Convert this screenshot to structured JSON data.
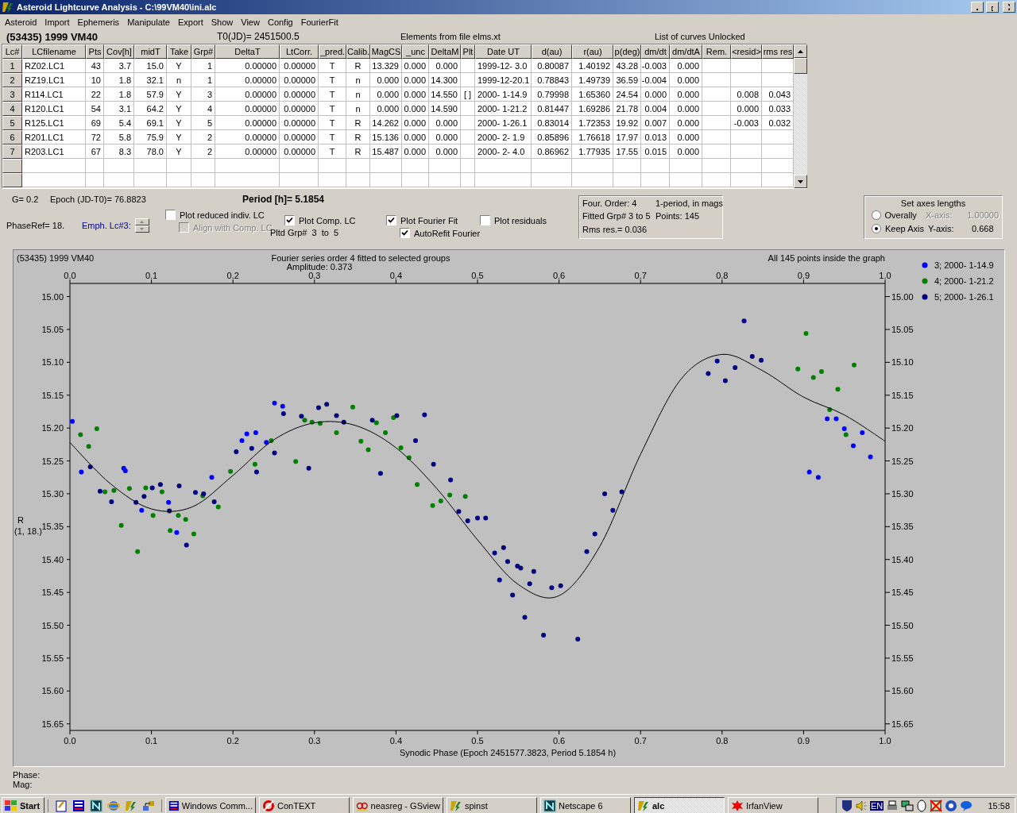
{
  "window": {
    "title": "Asteroid Lightcurve Analysis - C:\\99VM40\\ini.alc"
  },
  "menu": [
    "Asteroid",
    "Import",
    "Ephemeris",
    "Manipulate",
    "Export",
    "Show",
    "View",
    "Config",
    "FourierFit"
  ],
  "info": {
    "object": "(53435) 1999 VM40",
    "t0": "T0(JD)= 2451500.5",
    "elements": "Elements from file elms.xt",
    "list_state": "List of curves Unlocked"
  },
  "table": {
    "columns": [
      "Lc#",
      "LCfilename",
      "Pts",
      "Cov[h]",
      "midT",
      "Take",
      "Grp#",
      "DeltaT",
      "LtCorr.",
      "_pred.",
      "Calib.",
      "MagCS",
      "_unc",
      "DeltaM",
      "Plt",
      "Date UT",
      "d(au)",
      "r(au)",
      "p(deg)",
      "dm/dt",
      "dm/dtA",
      "Rem.",
      "<resid>",
      "rms res"
    ],
    "rows": [
      [
        "1",
        "RZ02.LC1",
        "43",
        "3.7",
        "15.0",
        "Y",
        "1",
        "0.00000",
        "0.00000",
        "T",
        "R",
        "13.329",
        "0.000",
        "0.000",
        null,
        "1999-12- 3.0",
        "0.80087",
        "1.40192",
        "43.28",
        "-0.003",
        "0.000",
        null,
        null,
        null
      ],
      [
        "2",
        "RZ19.LC1",
        "10",
        "1.8",
        "32.1",
        "n",
        "1",
        "0.00000",
        "0.00000",
        "T",
        "n",
        "0.000",
        "0.000",
        "14.300",
        null,
        "1999-12-20.1",
        "0.78843",
        "1.49739",
        "36.59",
        "-0.004",
        "0.000",
        null,
        null,
        null
      ],
      [
        "3",
        "R114.LC1",
        "22",
        "1.8",
        "57.9",
        "Y",
        "3",
        "0.00000",
        "0.00000",
        "T",
        "n",
        "0.000",
        "0.000",
        "14.550",
        "[ ]",
        "2000- 1-14.9",
        "0.79998",
        "1.65360",
        "24.54",
        "0.000",
        "0.000",
        null,
        "0.008",
        "0.043"
      ],
      [
        "4",
        "R120.LC1",
        "54",
        "3.1",
        "64.2",
        "Y",
        "4",
        "0.00000",
        "0.00000",
        "T",
        "n",
        "0.000",
        "0.000",
        "14.590",
        null,
        "2000- 1-21.2",
        "0.81447",
        "1.69286",
        "21.78",
        "0.004",
        "0.000",
        null,
        "0.000",
        "0.033"
      ],
      [
        "5",
        "R125.LC1",
        "69",
        "5.4",
        "69.1",
        "Y",
        "5",
        "0.00000",
        "0.00000",
        "T",
        "R",
        "14.262",
        "0.000",
        "0.000",
        null,
        "2000- 1-26.1",
        "0.83014",
        "1.72353",
        "19.92",
        "0.007",
        "0.000",
        null,
        "-0.003",
        "0.032"
      ],
      [
        "6",
        "R201.LC1",
        "72",
        "5.8",
        "75.9",
        "Y",
        "2",
        "0.00000",
        "0.00000",
        "T",
        "R",
        "15.136",
        "0.000",
        "0.000",
        null,
        "2000- 2- 1.9",
        "0.85896",
        "1.76618",
        "17.97",
        "0.013",
        "0.000",
        null,
        null,
        null
      ],
      [
        "7",
        "R203.LC1",
        "67",
        "8.3",
        "78.0",
        "Y",
        "2",
        "0.00000",
        "0.00000",
        "T",
        "R",
        "15.487",
        "0.000",
        "0.000",
        null,
        "2000- 2- 4.0",
        "0.86962",
        "1.77935",
        "17.55",
        "0.015",
        "0.000",
        null,
        null,
        null
      ]
    ]
  },
  "params": {
    "g": "G= 0.2",
    "epoch": "Epoch (JD-T0)= 76.8823",
    "period": "Period [h]= 5.1854",
    "phase_ref": "PhaseRef= 18.",
    "emph": "Emph. Lc#3:",
    "pltd_grp": "Pltd Grp#  3  to  5"
  },
  "checkboxes": [
    {
      "label": "Plot reduced indiv. LC",
      "checked": false,
      "disabled": false
    },
    {
      "label": "Align with Comp. LC",
      "checked": false,
      "disabled": true
    },
    {
      "label": "Plot Comp. LC",
      "checked": true,
      "disabled": false
    },
    {
      "label": "Plot Fourier Fit",
      "checked": true,
      "disabled": false
    },
    {
      "label": "AutoRefit Fourier",
      "checked": true,
      "disabled": false
    },
    {
      "label": "Plot residuals",
      "checked": false,
      "disabled": false
    }
  ],
  "fourier_box": {
    "lines": [
      [
        "Four. Order:  4",
        "1-period, in mags"
      ],
      [
        "Fitted Grp# 3 to 5",
        "Points: 145"
      ],
      [
        "Rms res.= 0.036"
      ]
    ]
  },
  "axes_box": {
    "title": "Set axes lengths",
    "options": [
      {
        "label": "Overally",
        "selected": false
      },
      {
        "label": "Keep Axis",
        "selected": true
      }
    ],
    "values": [
      {
        "label": "X-axis:",
        "value": "1.00000",
        "disabled": true
      },
      {
        "label": "Y-axis:",
        "value": "0.668",
        "disabled": false
      }
    ]
  },
  "chart": {
    "object": "(53435) 1999 VM40",
    "title": "Fourier series order 4 fitted to selected groups",
    "amplitude": "Amplitude: 0.373",
    "points_note": "All 145 points inside the graph",
    "y_note": "(1, 18.)",
    "chart_data": {
      "type": "scatter",
      "xlabel": "Synodic Phase (Epoch 2451577.3823, Period 5.1854 h)",
      "ylabel": "R",
      "legend": "right",
      "xlim": [
        0,
        1
      ],
      "ylim": [
        15.66,
        14.98
      ],
      "xticks": [
        {
          "value": 0,
          "label": "0.0"
        },
        {
          "value": 0.1,
          "label": "0.1"
        },
        {
          "value": 0.2,
          "label": "0.2"
        },
        {
          "value": 0.3,
          "label": "0.3"
        },
        {
          "value": 0.4,
          "label": "0.4"
        },
        {
          "value": 0.5,
          "label": "0.5"
        },
        {
          "value": 0.6,
          "label": "0.6"
        },
        {
          "value": 0.7,
          "label": "0.7"
        },
        {
          "value": 0.8,
          "label": "0.8"
        },
        {
          "value": 0.9,
          "label": "0.9"
        },
        {
          "value": 1,
          "label": "1.0"
        }
      ],
      "yticks": [
        {
          "value": 15,
          "label": "15.00"
        },
        {
          "value": 15.05,
          "label": "15.05"
        },
        {
          "value": 15.1,
          "label": "15.10"
        },
        {
          "value": 15.15,
          "label": "15.15"
        },
        {
          "value": 15.2,
          "label": "15.20"
        },
        {
          "value": 15.25,
          "label": "15.25"
        },
        {
          "value": 15.3,
          "label": "15.30"
        },
        {
          "value": 15.35,
          "label": "15.35"
        },
        {
          "value": 15.4,
          "label": "15.40"
        },
        {
          "value": 15.45,
          "label": "15.45"
        },
        {
          "value": 15.5,
          "label": "15.50"
        },
        {
          "value": 15.55,
          "label": "15.55"
        },
        {
          "value": 15.6,
          "label": "15.60"
        },
        {
          "value": 15.65,
          "label": "15.65"
        }
      ],
      "series": [
        {
          "type": "scatter",
          "name": "3; 2000- 1-14.9",
          "color": "#0000ff",
          "x": [
            0.003,
            0.014,
            0.066,
            0.068,
            0.088,
            0.121,
            0.131,
            0.174,
            0.211,
            0.217,
            0.228,
            0.241,
            0.251,
            0.261,
            0.907,
            0.918,
            0.929,
            0.94,
            0.95,
            0.961,
            0.972,
            0.982
          ],
          "values": [
            15.19,
            15.267,
            15.261,
            15.265,
            15.325,
            15.313,
            15.359,
            15.275,
            15.219,
            15.209,
            15.207,
            15.222,
            15.162,
            15.167,
            15.267,
            15.275,
            15.186,
            15.186,
            15.201,
            15.227,
            15.207,
            15.244
          ]
        },
        {
          "type": "scatter",
          "name": "4; 2000- 1-21.2",
          "color": "#008000",
          "x": [
            0.013,
            0.023,
            0.033,
            0.043,
            0.054,
            0.063,
            0.073,
            0.083,
            0.093,
            0.102,
            0.113,
            0.123,
            0.133,
            0.142,
            0.152,
            0.163,
            0.182,
            0.197,
            0.227,
            0.247,
            0.277,
            0.288,
            0.297,
            0.307,
            0.327,
            0.347,
            0.357,
            0.366,
            0.376,
            0.387,
            0.397,
            0.406,
            0.416,
            0.426,
            0.445,
            0.455,
            0.466,
            0.485,
            0.893,
            0.903,
            0.912,
            0.922,
            0.932,
            0.942,
            0.952,
            0.962
          ],
          "values": [
            15.21,
            15.228,
            15.201,
            15.297,
            15.295,
            15.348,
            15.292,
            15.388,
            15.291,
            15.333,
            15.297,
            15.356,
            15.333,
            15.339,
            15.361,
            15.303,
            15.32,
            15.266,
            15.255,
            15.219,
            15.251,
            15.188,
            15.191,
            15.193,
            15.207,
            15.168,
            15.22,
            15.233,
            15.192,
            15.207,
            15.184,
            15.23,
            15.245,
            15.286,
            15.318,
            15.311,
            15.302,
            15.304,
            15.11,
            15.056,
            15.123,
            15.114,
            15.172,
            15.141,
            15.21,
            15.104
          ]
        },
        {
          "type": "scatter",
          "name": "5; 2000- 1-26.1",
          "color": "#000080",
          "x": [
            0.025,
            0.037,
            0.051,
            0.081,
            0.091,
            0.101,
            0.111,
            0.122,
            0.134,
            0.143,
            0.154,
            0.164,
            0.177,
            0.204,
            0.223,
            0.229,
            0.251,
            0.262,
            0.284,
            0.293,
            0.305,
            0.315,
            0.327,
            0.336,
            0.371,
            0.381,
            0.401,
            0.424,
            0.435,
            0.446,
            0.467,
            0.477,
            0.488,
            0.5,
            0.51,
            0.521,
            0.527,
            0.532,
            0.537,
            0.543,
            0.549,
            0.553,
            0.558,
            0.564,
            0.569,
            0.581,
            0.591,
            0.602,
            0.623,
            0.634,
            0.644,
            0.656,
            0.666,
            0.677,
            0.783,
            0.794,
            0.804,
            0.816,
            0.827,
            0.837,
            0.848
          ],
          "values": [
            15.259,
            15.296,
            15.312,
            15.313,
            15.304,
            15.291,
            15.286,
            15.326,
            15.288,
            15.378,
            15.298,
            15.3,
            15.312,
            15.236,
            15.231,
            15.267,
            15.238,
            15.178,
            15.182,
            15.261,
            15.169,
            15.164,
            15.181,
            15.191,
            15.188,
            15.269,
            15.181,
            15.219,
            15.18,
            15.255,
            15.279,
            15.327,
            15.341,
            15.337,
            15.337,
            15.39,
            15.431,
            15.382,
            15.403,
            15.454,
            15.41,
            15.413,
            15.488,
            15.437,
            15.418,
            15.515,
            15.443,
            15.44,
            15.521,
            15.388,
            15.361,
            15.3,
            15.325,
            15.297,
            15.117,
            15.098,
            15.128,
            15.108,
            15.037,
            15.091,
            15.097
          ]
        },
        {
          "type": "line",
          "color": "#000000",
          "x": [
            0,
            0.05,
            0.1,
            0.15,
            0.2,
            0.25,
            0.3,
            0.35,
            0.4,
            0.45,
            0.5,
            0.55,
            0.6,
            0.65,
            0.7,
            0.75,
            0.8,
            0.85,
            0.9,
            0.95,
            1
          ],
          "values": [
            15.222,
            15.285,
            15.323,
            15.32,
            15.272,
            15.218,
            15.192,
            15.196,
            15.23,
            15.292,
            15.37,
            15.438,
            15.455,
            15.38,
            15.24,
            15.125,
            15.088,
            15.113,
            15.153,
            15.18,
            15.22
          ]
        }
      ]
    }
  },
  "status": {
    "phase": "Phase:",
    "mag": "Mag:"
  },
  "taskbar": {
    "start": "Start",
    "tasks": [
      {
        "label": "Windows Comm...",
        "selected": false
      },
      {
        "label": "ConTEXT",
        "selected": false
      },
      {
        "label": "neasreg - GSview",
        "selected": false
      },
      {
        "label": "spinst",
        "selected": false
      },
      {
        "label": "Netscape 6",
        "selected": false
      },
      {
        "label": "alc",
        "selected": true
      },
      {
        "label": "IrfanView",
        "selected": false
      }
    ],
    "language": "EN",
    "clock": "15:58"
  }
}
